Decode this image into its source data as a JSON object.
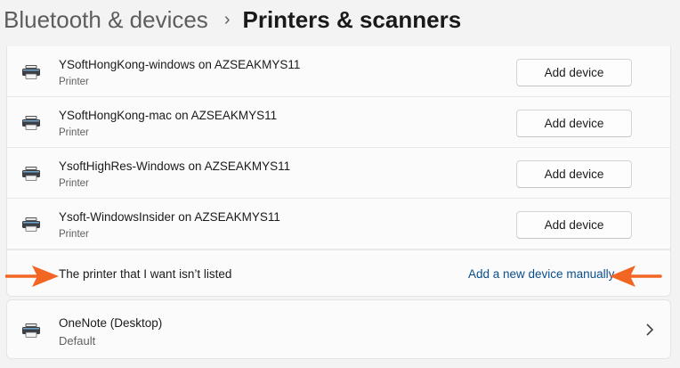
{
  "breadcrumb": {
    "parent": "Bluetooth & devices",
    "current": "Printers & scanners"
  },
  "printers": [
    {
      "name": "YSoftHongKong-windows on AZSEAKMYS11",
      "type": "Printer",
      "action": "Add device"
    },
    {
      "name": "YSoftHongKong-mac on AZSEAKMYS11",
      "type": "Printer",
      "action": "Add device"
    },
    {
      "name": "YsoftHighRes-Windows on AZSEAKMYS11",
      "type": "Printer",
      "action": "Add device"
    },
    {
      "name": "Ysoft-WindowsInsider on AZSEAKMYS11",
      "type": "Printer",
      "action": "Add device"
    }
  ],
  "not_listed": {
    "text": "The printer that I want isn’t listed",
    "link": "Add a new device manually"
  },
  "installed": {
    "name": "OneNote (Desktop)",
    "status": "Default"
  },
  "icons": {
    "printer": "printer-icon",
    "chevron": "chevron-right-icon"
  },
  "colors": {
    "background": "#f3f3f3",
    "card": "#fbfbfb",
    "link": "#0a4e8c",
    "arrow_annotation": "#f26522"
  }
}
